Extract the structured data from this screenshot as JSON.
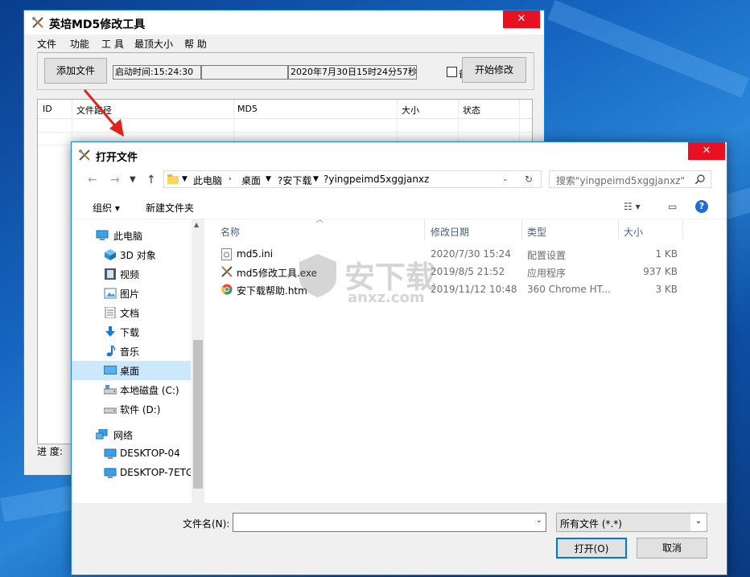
{
  "app": {
    "title": "英培MD5修改工具",
    "close": "✕",
    "menu": [
      "文件",
      "功能",
      "工 具",
      "最顶大小",
      "帮 助"
    ],
    "add_file_button": "添加文件",
    "start_time": "启动时间:15:24:30",
    "datetime": "2020年7月30日15时24分57秒",
    "backup_label": "备份",
    "start_button": "开始修改",
    "columns": [
      "ID",
      "文件路径",
      "MD5",
      "大小",
      "状态"
    ],
    "progress_label": "进  度:"
  },
  "dialog": {
    "title": "打开文件",
    "close": "✕",
    "breadcrumb": [
      "此电脑",
      "桌面",
      "?安下载",
      "?yingpeimd5xggjanxz"
    ],
    "search_placeholder": "搜索\"yingpeimd5xggjanxz\"",
    "organize": "组织 ▾",
    "new_folder": "新建文件夹",
    "help": "?",
    "nav": [
      {
        "label": "此电脑",
        "icon": "computer-icon"
      },
      {
        "label": "3D 对象",
        "icon": "cube-icon"
      },
      {
        "label": "视频",
        "icon": "video-icon"
      },
      {
        "label": "图片",
        "icon": "picture-icon"
      },
      {
        "label": "文档",
        "icon": "document-icon"
      },
      {
        "label": "下载",
        "icon": "download-icon"
      },
      {
        "label": "音乐",
        "icon": "music-icon"
      },
      {
        "label": "桌面",
        "icon": "desktop-icon"
      },
      {
        "label": "本地磁盘 (C:)",
        "icon": "drive-icon"
      },
      {
        "label": "软件 (D:)",
        "icon": "drive-icon"
      },
      {
        "label": "网络",
        "icon": "network-icon"
      },
      {
        "label": "DESKTOP-04",
        "icon": "monitor-icon"
      },
      {
        "label": "DESKTOP-7ETG",
        "icon": "monitor-icon"
      }
    ],
    "file_columns": [
      "名称",
      "修改日期",
      "类型",
      "大小"
    ],
    "files": [
      {
        "name": "md5.ini",
        "date": "2020/7/30 15:24",
        "type": "配置设置",
        "size": "1 KB",
        "icon": "ini-file-icon"
      },
      {
        "name": "md5修改工具.exe",
        "date": "2019/8/5 21:52",
        "type": "应用程序",
        "size": "937 KB",
        "icon": "tool-icon"
      },
      {
        "name": "安下载帮助.htm",
        "date": "2019/11/12 10:48",
        "type": "360 Chrome HT...",
        "size": "3 KB",
        "icon": "chrome-icon"
      }
    ],
    "filename_label": "文件名(N):",
    "filename_value": "",
    "filter_value": "所有文件 (*.*)",
    "open_button": "打开(O)",
    "cancel_button": "取消"
  },
  "watermark": {
    "text": "安下载",
    "sub": "anxz.com"
  },
  "colors": {
    "accent": "#1883d7",
    "close": "#e81123",
    "selection": "#cce8ff",
    "arrow": "#e0241c"
  }
}
